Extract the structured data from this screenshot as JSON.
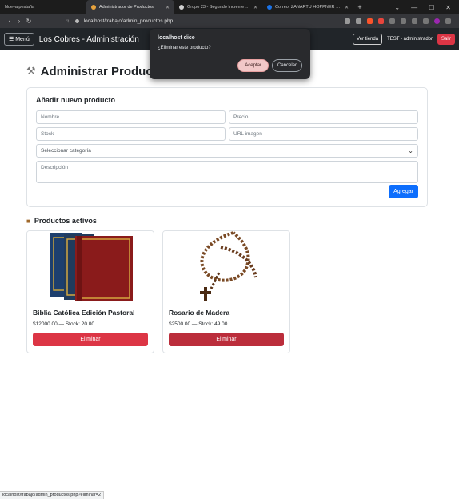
{
  "browser": {
    "tabs": [
      {
        "label": "Nueva pestaña"
      },
      {
        "label": "Administrador de Productos"
      },
      {
        "label": "Grupo 23 - Segundo Incremento Sci"
      },
      {
        "label": "Correo: ZAÑARTU HOPPNER IGNACI"
      }
    ],
    "url": "localhost/trabajo/admin_productos.php",
    "status_url": "localhost/trabajo/admin_productos.php?eliminar=2",
    "colors": {
      "active_tab": "#35363a",
      "chrome": "#1c1c1c"
    }
  },
  "nav": {
    "menu_label": "☰ Menú",
    "brand": "Los Cobres - Administración",
    "view_store": "Ver tienda",
    "user": "TEST - administrador",
    "logout": "Salir"
  },
  "page": {
    "title": "Administrar Product",
    "title_icon": "tools-icon"
  },
  "form": {
    "heading": "Añadir nuevo producto",
    "name_placeholder": "Nombre",
    "price_placeholder": "Precio",
    "stock_placeholder": "Stock",
    "image_placeholder": "URL imagen",
    "category_value": "Seleccionar categoría",
    "description_placeholder": "Descripción",
    "submit": "Agregar"
  },
  "products_section": {
    "title": "Productos activos",
    "icon": "box-icon",
    "items": [
      {
        "name": "Biblia Católica Edición Pastoral",
        "info": "$12000.00 — Stock: 20.00",
        "delete": "Eliminar"
      },
      {
        "name": "Rosario de Madera",
        "info": "$2500.00 — Stock: 49.00",
        "delete": "Eliminar"
      }
    ]
  },
  "dialog": {
    "title": "localhost dice",
    "message": "¿Eliminar este producto?",
    "ok": "Aceptar",
    "cancel": "Cancelar"
  }
}
